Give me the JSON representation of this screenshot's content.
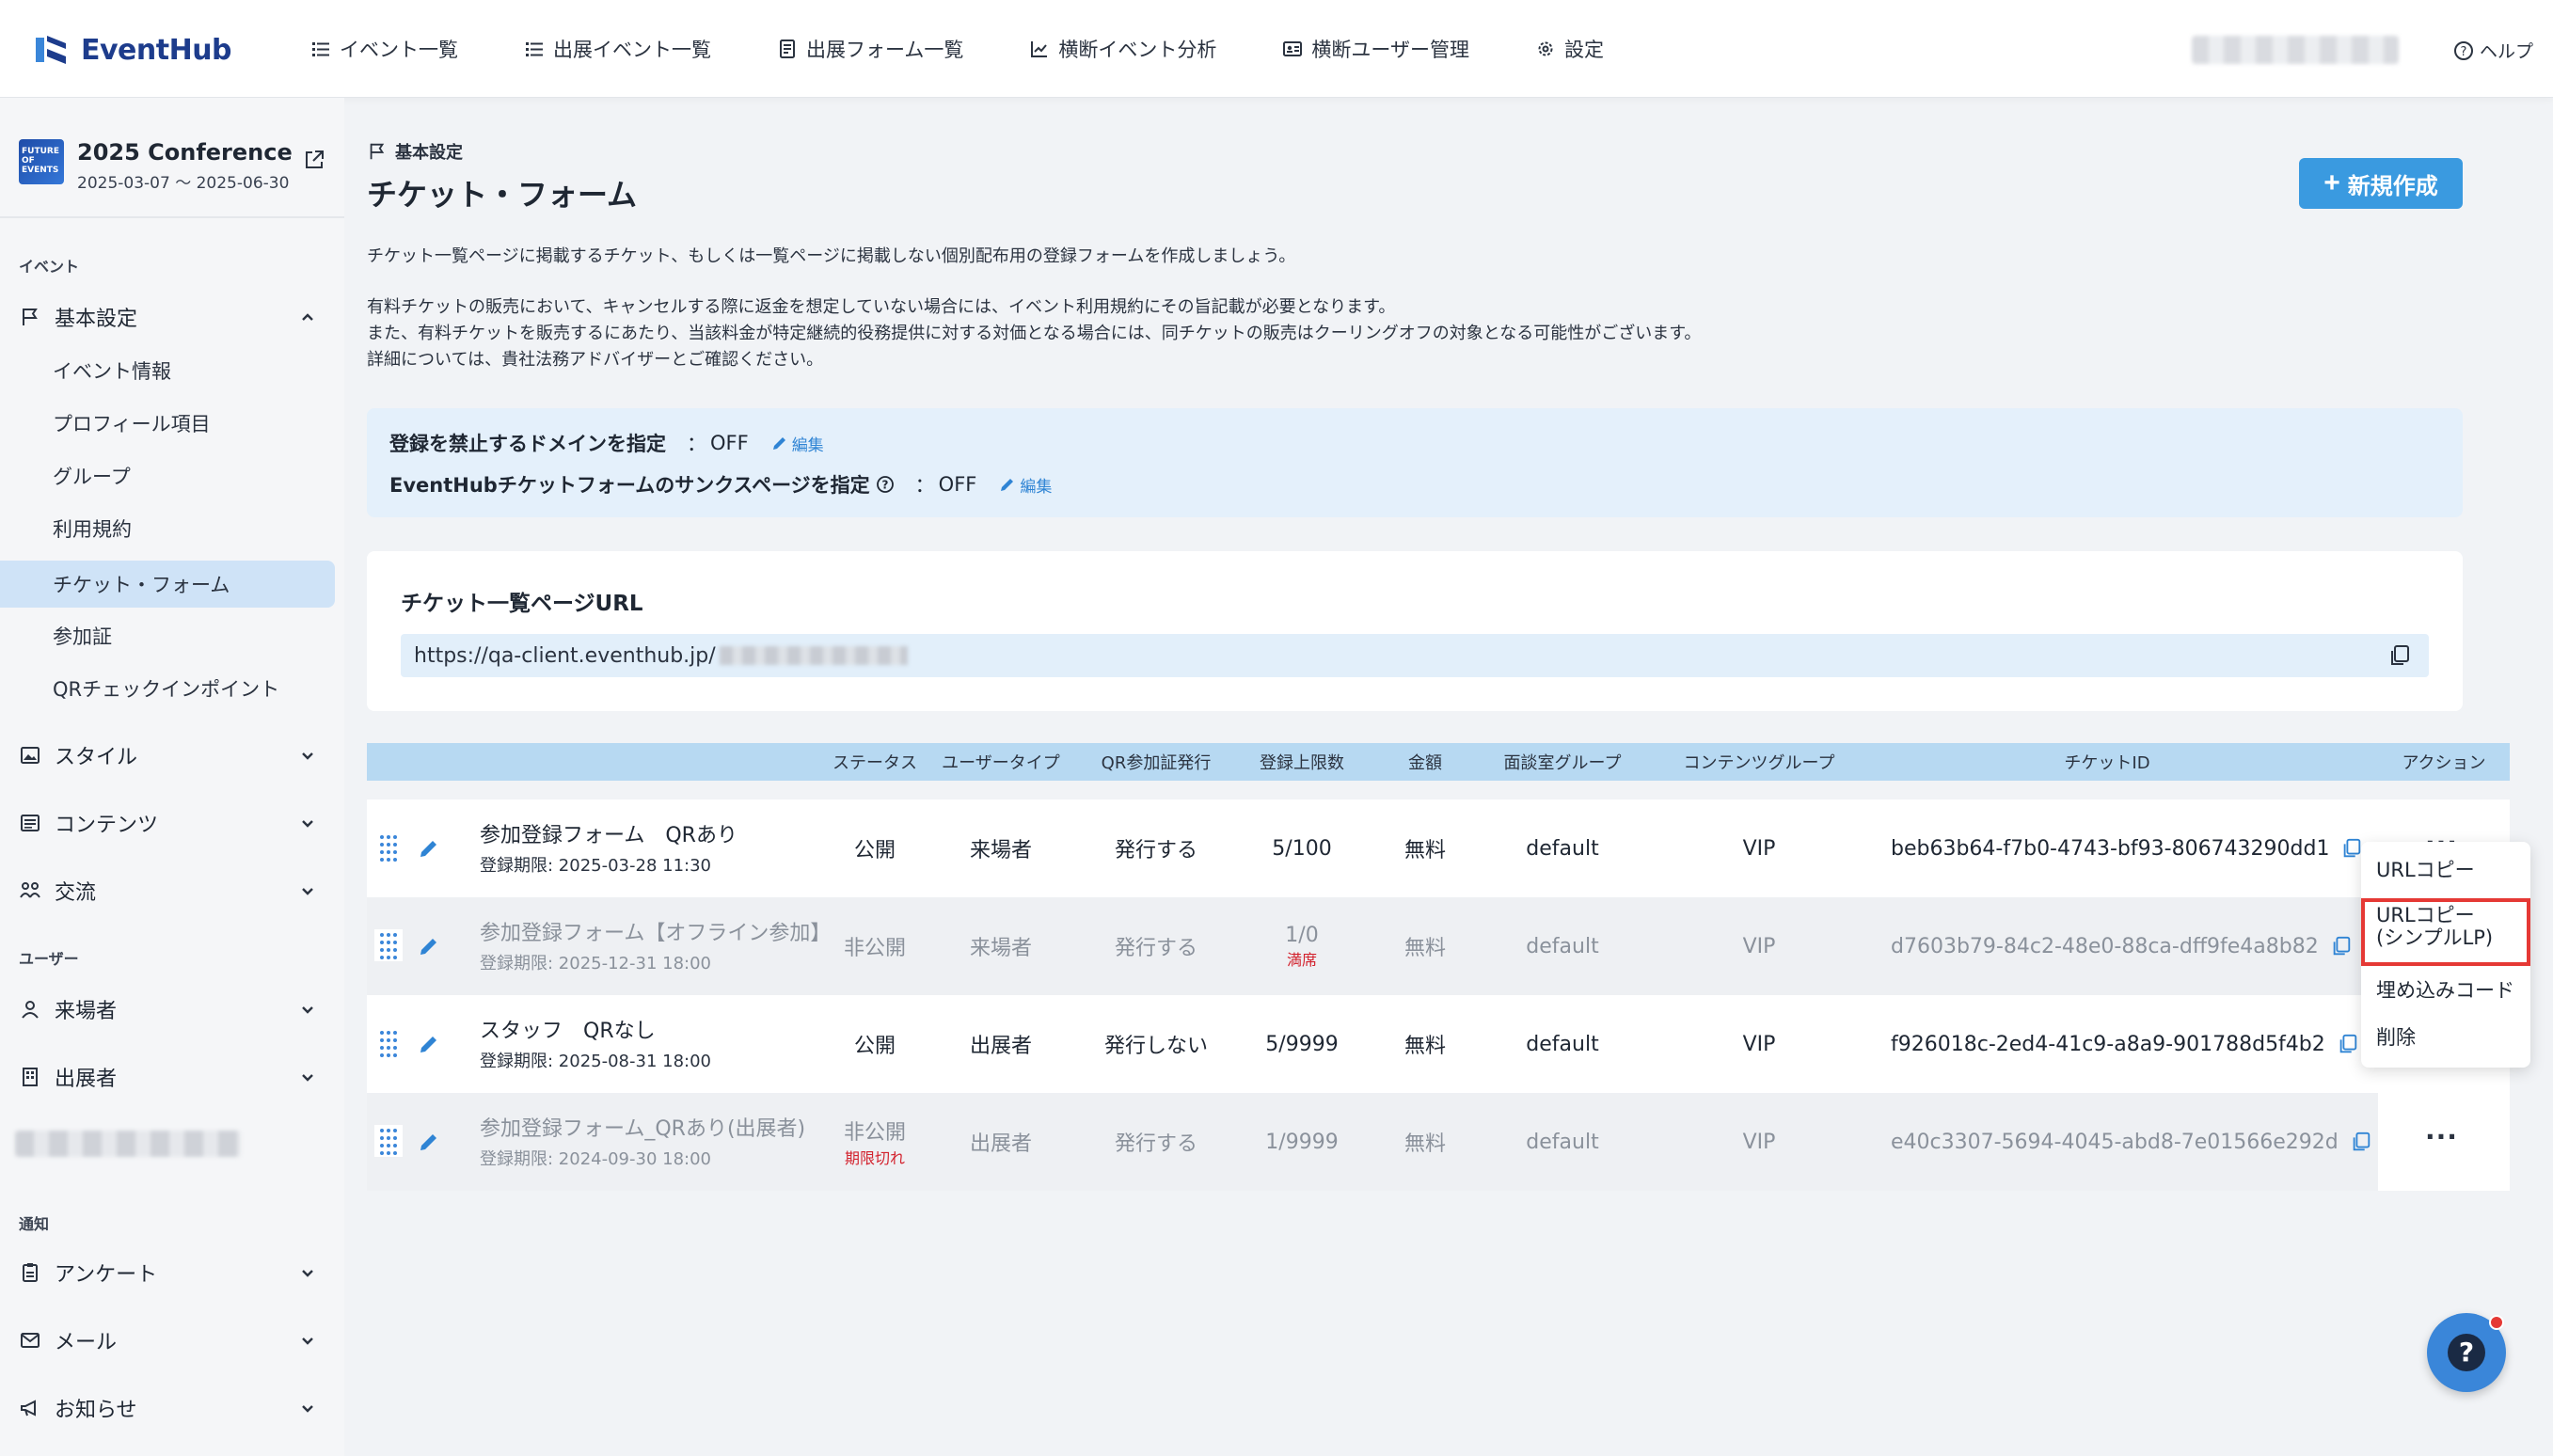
{
  "app": {
    "logo_text": "EventHub",
    "brand_color": "#1d3c8c",
    "accent": "#3a9ae0"
  },
  "nav": [
    {
      "label": "イベント一覧",
      "icon": "list-icon"
    },
    {
      "label": "出展イベント一覧",
      "icon": "list-icon"
    },
    {
      "label": "出展フォーム一覧",
      "icon": "form-icon"
    },
    {
      "label": "横断イベント分析",
      "icon": "chart-icon"
    },
    {
      "label": "横断ユーザー管理",
      "icon": "id-card-icon"
    },
    {
      "label": "設定",
      "icon": "gear-icon"
    }
  ],
  "help_label": "ヘルプ",
  "event": {
    "title": "2025 Conference",
    "dates": "2025-03-07 ～ 2025-06-30",
    "thumb_text": "FUTURE OF EVENTS"
  },
  "sidebar": {
    "section_event": "イベント",
    "basic": "基本設定",
    "basic_items": [
      "イベント情報",
      "プロフィール項目",
      "グループ",
      "利用規約",
      "チケット・フォーム",
      "参加証",
      "QRチェックインポイント"
    ],
    "style": "スタイル",
    "contents": "コンテンツ",
    "exchange": "交流",
    "section_user": "ユーザー",
    "visitors": "来場者",
    "exhibitors": "出展者",
    "section_notice": "通知",
    "survey": "アンケート",
    "mail": "メール",
    "news": "お知らせ"
  },
  "page": {
    "breadcrumb": "基本設定",
    "title": "チケット・フォーム",
    "new_button": "新規作成",
    "desc1": "チケット一覧ページに掲載するチケット、もしくは一覧ページに掲載しない個別配布用の登録フォームを作成しましょう。",
    "desc2": "有料チケットの販売において、キャンセルする際に返金を想定していない場合には、イベント利用規約にその旨記載が必要となります。",
    "desc3": "また、有料チケットを販売するにあたり、当該料金が特定継続的役務提供に対する対価となる場合には、同チケットの販売はクーリングオフの対象となる可能性がございます。",
    "desc4": "詳細については、貴社法務アドバイザーとご確認ください。"
  },
  "settings": {
    "domain_label": "登録を禁止するドメインを指定",
    "domain_colon": "：",
    "domain_value": "OFF",
    "thanks_label": "EventHubチケットフォームのサンクスページを指定",
    "thanks_colon": "：",
    "thanks_value": "OFF",
    "edit": "編集"
  },
  "url_card": {
    "label": "チケット一覧ページURL",
    "url": "https://qa-client.eventhub.jp/"
  },
  "table": {
    "headers": [
      "ステータス",
      "ユーザータイプ",
      "QR参加証発行",
      "登録上限数",
      "金額",
      "面談室グループ",
      "コンテンツグループ",
      "チケットID",
      "アクション"
    ],
    "rows": [
      {
        "name": "参加登録フォーム　QRあり",
        "deadline": "登録期限: 2025-03-28 11:30",
        "status": "公開",
        "status_note": "",
        "user_type": "来場者",
        "qr": "発行する",
        "limit": "5/100",
        "limit_note": "",
        "price": "無料",
        "room": "default",
        "content": "VIP",
        "id": "beb63b64-f7b0-4743-bf93-806743290dd1"
      },
      {
        "name": "参加登録フォーム【オフライン参加】",
        "deadline": "登録期限: 2025-12-31 18:00",
        "status": "非公開",
        "status_note": "",
        "user_type": "来場者",
        "qr": "発行する",
        "limit": "1/0",
        "limit_note": "満席",
        "price": "無料",
        "room": "default",
        "content": "VIP",
        "id": "d7603b79-84c2-48e0-88ca-dff9fe4a8b82"
      },
      {
        "name": "スタッフ　QRなし",
        "deadline": "登録期限: 2025-08-31 18:00",
        "status": "公開",
        "status_note": "",
        "user_type": "出展者",
        "qr": "発行しない",
        "limit": "5/9999",
        "limit_note": "",
        "price": "無料",
        "room": "default",
        "content": "VIP",
        "id": "f926018c-2ed4-41c9-a8a9-901788d5f4b2"
      },
      {
        "name": "参加登録フォーム_QRあり(出展者)",
        "deadline": "登録期限: 2024-09-30 18:00",
        "status": "非公開",
        "status_note": "期限切れ",
        "user_type": "出展者",
        "qr": "発行する",
        "limit": "1/9999",
        "limit_note": "",
        "price": "無料",
        "room": "default",
        "content": "VIP",
        "id": "e40c3307-5694-4045-abd8-7e01566e292d"
      }
    ],
    "action_dots": "···"
  },
  "menu": {
    "copy_url": "URLコピー",
    "copy_simple_1": "URLコピー",
    "copy_simple_2": "(シンプルLP)",
    "embed": "埋め込みコード",
    "delete": "削除"
  }
}
